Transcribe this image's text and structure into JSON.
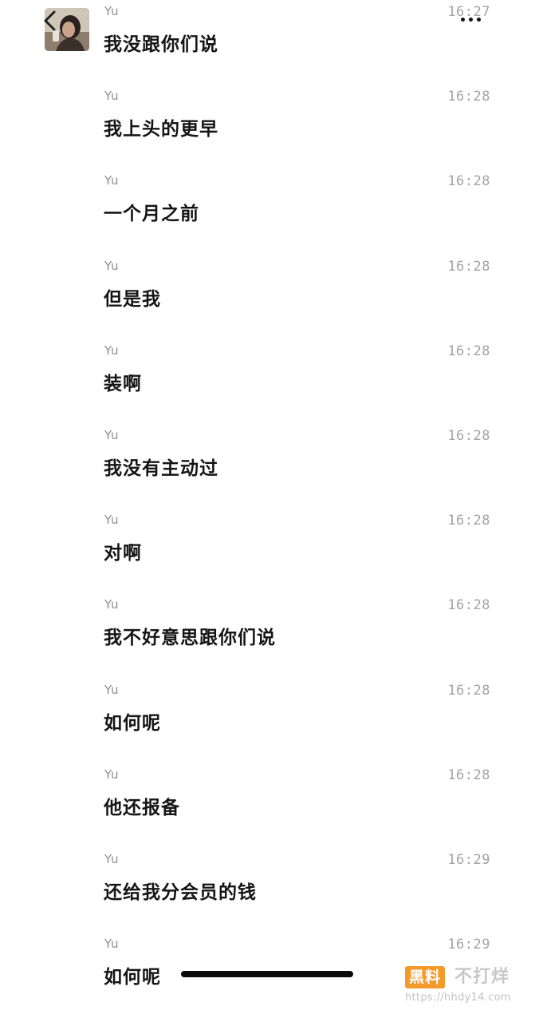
{
  "header": {
    "back_icon": "chevron-left-icon",
    "more_icon": "more-dots-icon"
  },
  "messages": [
    {
      "sender": "Yu",
      "time": "16:27",
      "text": "我没跟你们说"
    },
    {
      "sender": "Yu",
      "time": "16:28",
      "text": "我上头的更早"
    },
    {
      "sender": "Yu",
      "time": "16:28",
      "text": "一个月之前"
    },
    {
      "sender": "Yu",
      "time": "16:28",
      "text": "但是我"
    },
    {
      "sender": "Yu",
      "time": "16:28",
      "text": "装啊"
    },
    {
      "sender": "Yu",
      "time": "16:28",
      "text": "我没有主动过"
    },
    {
      "sender": "Yu",
      "time": "16:28",
      "text": "对啊"
    },
    {
      "sender": "Yu",
      "time": "16:28",
      "text": "我不好意思跟你们说"
    },
    {
      "sender": "Yu",
      "time": "16:28",
      "text": "如何呢"
    },
    {
      "sender": "Yu",
      "time": "16:28",
      "text": "他还报备"
    },
    {
      "sender": "Yu",
      "time": "16:29",
      "text": "还给我分会员的钱"
    },
    {
      "sender": "Yu",
      "time": "16:29",
      "text": "如何呢"
    }
  ],
  "watermark": {
    "logo": "黑料",
    "brand": "不打烊",
    "url": "https://hhdy14.com"
  },
  "colors": {
    "background": "#ffffff",
    "message_text": "#151515",
    "meta_text": "#a3a3a3",
    "watermark_accent": "#f39a2a"
  }
}
